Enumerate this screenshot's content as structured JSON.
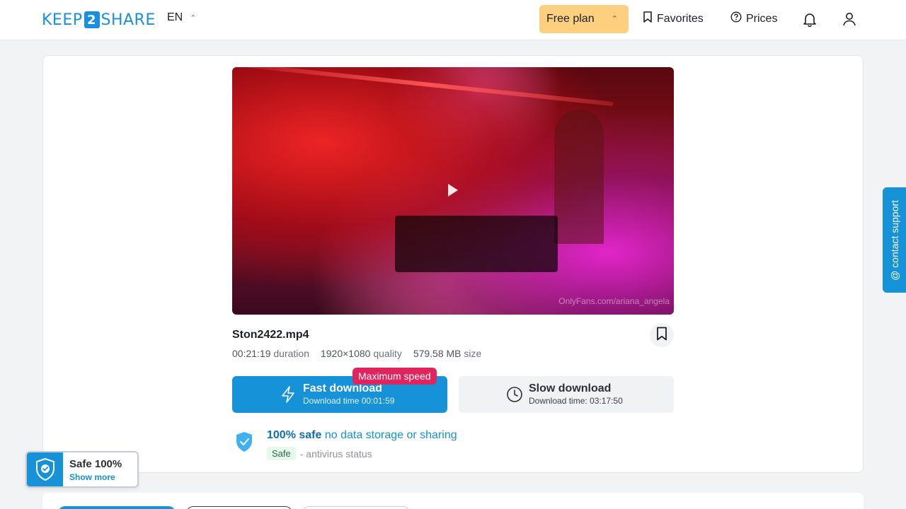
{
  "header": {
    "logo_left": "KEEP",
    "logo_num": "2",
    "logo_right": "SHARE",
    "lang": "EN",
    "plan_label": "Free plan",
    "favorites_label": "Favorites",
    "prices_label": "Prices"
  },
  "file": {
    "name": "Ston2422.mp4",
    "duration_value": "00:21:19",
    "duration_label": "duration",
    "quality_value": "1920×1080",
    "quality_label": "quality",
    "size_value": "579.58 MB",
    "size_label": "size",
    "watermark": "OnlyFans.com/ariana_angela"
  },
  "download": {
    "max_speed_badge": "Maximum speed",
    "fast_title": "Fast download",
    "fast_time": "Download time 00:01:59",
    "slow_title": "Slow download",
    "slow_time": "Download time: 03:17:50"
  },
  "safety": {
    "headline_bold": "100% safe",
    "headline_rest": "no data storage or sharing",
    "tag": "Safe",
    "status": "- antivirus status"
  },
  "widget": {
    "title": "Safe 100%",
    "link": "Show more"
  },
  "contact": {
    "label": "@ contact support"
  },
  "colors": {
    "accent": "#1592d8",
    "plan_bg": "#fcd07e",
    "badge": "#e0245e"
  }
}
